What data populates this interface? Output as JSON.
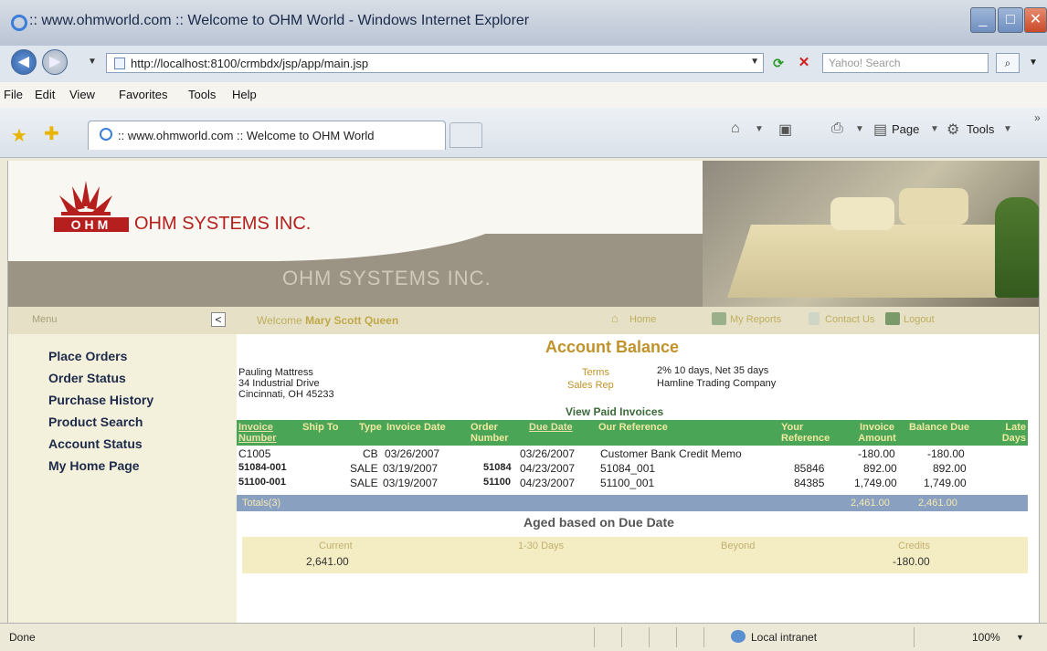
{
  "window": {
    "title": ":: www.ohmworld.com :: Welcome to OHM World - Windows Internet Explorer",
    "min_glyph": "_",
    "max_glyph": "□",
    "close_glyph": "✕"
  },
  "address": {
    "url": "http://localhost:8100/crmbdx/jsp/app/main.jsp",
    "search_placeholder": "Yahoo! Search"
  },
  "menu": [
    "File",
    "Edit",
    "View",
    "Favorites",
    "Tools",
    "Help"
  ],
  "tab": {
    "title": ":: www.ohmworld.com :: Welcome to OHM World"
  },
  "toolbar": {
    "page": "Page",
    "tools": "Tools"
  },
  "banner": {
    "logo_mark": "OHM",
    "company": "OHM SYSTEMS INC.",
    "tagline": "OHM SYSTEMS INC."
  },
  "nav": {
    "menu_label": "Menu",
    "welcome_prefix": "Welcome",
    "user": "Mary Scott Queen",
    "home": "Home",
    "reports": "My Reports",
    "contact": "Contact Us",
    "logout": "Logout"
  },
  "sidebar": {
    "items": [
      "Place Orders",
      "Order Status",
      "Purchase History",
      "Product Search",
      "Account Status",
      "My Home Page"
    ]
  },
  "account": {
    "title": "Account Balance",
    "customer": [
      "Pauling Mattress",
      "34 Industrial Drive",
      "Cincinnati, OH 45233"
    ],
    "terms_label": "Terms",
    "terms_value": "2% 10 days, Net 35 days",
    "salesrep_label": "Sales Rep",
    "salesrep_value": "Hamline Trading Company",
    "view_paid": "View Paid Invoices"
  },
  "invoices": {
    "headers": {
      "invoice_number": "Invoice Number",
      "ship_to": "Ship To",
      "type": "Type",
      "invoice_date": "Invoice Date",
      "order_number": "Order Number",
      "due_date": "Due Date",
      "our_reference": "Our Reference",
      "your_reference": "Your Reference",
      "invoice_amount": "Invoice Amount",
      "balance_due": "Balance Due",
      "late_days": "Late Days"
    },
    "rows": [
      {
        "invoice": "C1005",
        "type": "CB",
        "invoice_date": "03/26/2007",
        "order": "",
        "due_date": "03/26/2007",
        "our_ref": "Customer Bank Credit Memo",
        "your_ref": "",
        "amount": "-180.00",
        "balance": "-180.00"
      },
      {
        "invoice": "51084-001",
        "type": "SALE",
        "invoice_date": "03/19/2007",
        "order": "51084",
        "due_date": "04/23/2007",
        "our_ref": "51084_001",
        "your_ref": "85846",
        "amount": "892.00",
        "balance": "892.00"
      },
      {
        "invoice": "51100-001",
        "type": "SALE",
        "invoice_date": "03/19/2007",
        "order": "51100",
        "due_date": "04/23/2007",
        "our_ref": "51100_001",
        "your_ref": "84385",
        "amount": "1,749.00",
        "balance": "1,749.00"
      }
    ],
    "totals_label": "Totals(3)",
    "total_amount": "2,461.00",
    "total_balance": "2,461.00"
  },
  "aged": {
    "title": "Aged based on Due Date",
    "current_label": "Current",
    "days_label": "1-30 Days",
    "beyond_label": "Beyond",
    "credits_label": "Credits",
    "current_value": "2,641.00",
    "credits_value": "-180.00"
  },
  "status": {
    "text": "Done",
    "zone": "Local intranet",
    "zoom": "100%"
  }
}
